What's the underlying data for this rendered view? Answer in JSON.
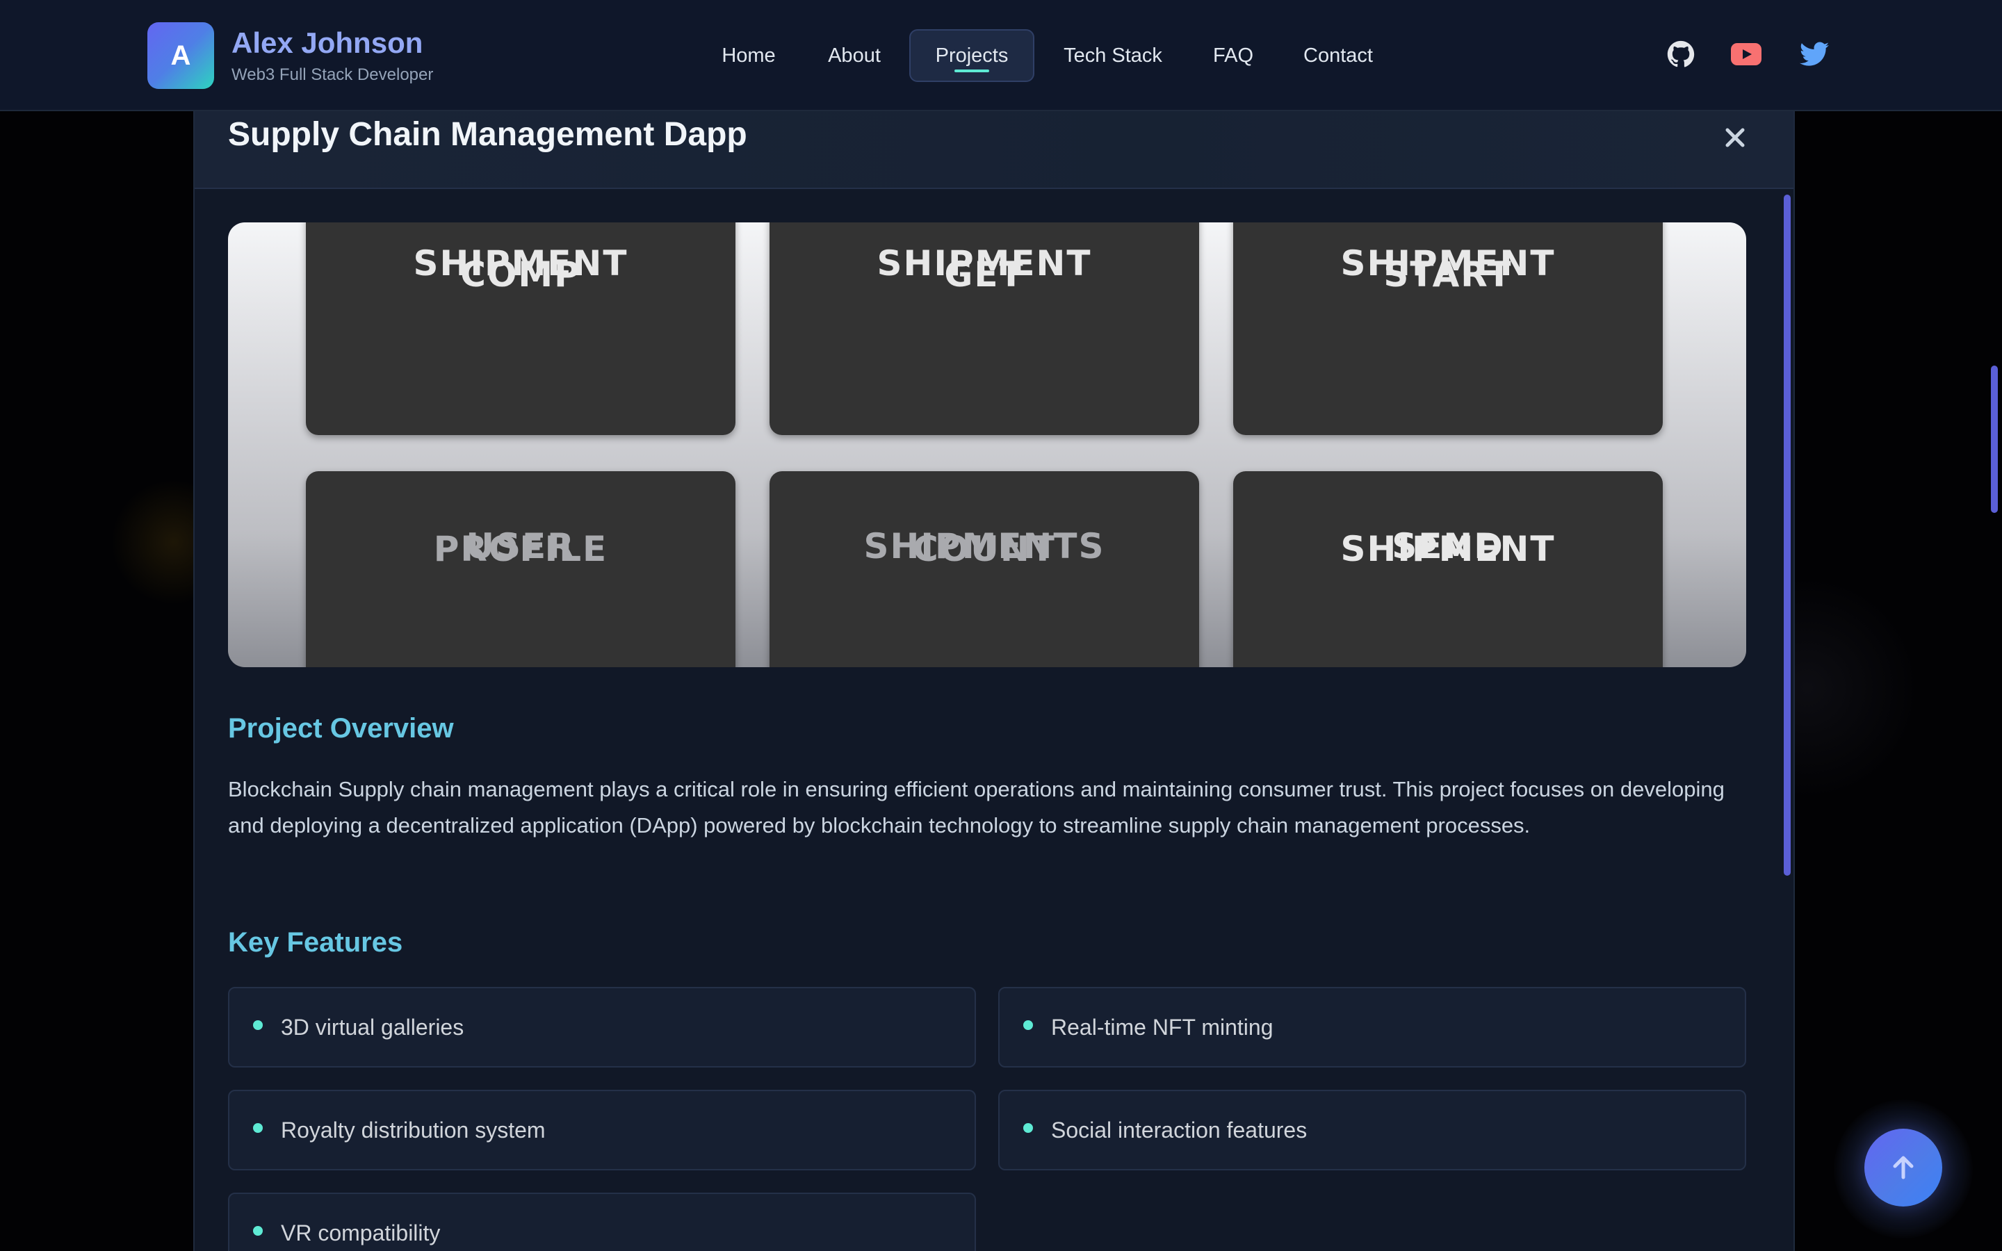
{
  "brand": {
    "initial": "A",
    "name": "Alex Johnson",
    "role": "Web3 Full Stack Developer"
  },
  "nav": {
    "items": [
      {
        "label": "Home",
        "active": false
      },
      {
        "label": "About",
        "active": false
      },
      {
        "label": "Projects",
        "active": true
      },
      {
        "label": "Tech Stack",
        "active": false
      },
      {
        "label": "FAQ",
        "active": false
      },
      {
        "label": "Contact",
        "active": false
      }
    ]
  },
  "social": [
    "github-icon",
    "youtube-icon",
    "twitter-icon"
  ],
  "modal": {
    "title": "Supply Chain Management Dapp",
    "close_icon": "close-icon",
    "hero_tiles": [
      {
        "line1": "COMP",
        "line2": "SHIPMENT"
      },
      {
        "line1": "GET",
        "line2": "SHIPMENT"
      },
      {
        "line1": "START",
        "line2": "SHIPMENT"
      },
      {
        "line1": "USER",
        "line2": "PROFILE"
      },
      {
        "line1": "SHIPMENTS",
        "line2": "COUNT"
      },
      {
        "line1": "SEND",
        "line2": "SHIPMENT"
      }
    ],
    "overview_heading": "Project Overview",
    "overview_text": "Blockchain Supply chain management plays a critical role in ensuring efficient operations and maintaining consumer trust. This project focuses on developing and deploying a decentralized application (DApp) powered by blockchain technology to streamline supply chain management processes.",
    "features_heading": "Key Features",
    "features": [
      "3D virtual galleries",
      "Real-time NFT minting",
      "Royalty distribution system",
      "Social interaction features",
      "VR compatibility"
    ]
  },
  "scroll_top_icon": "arrow-up-icon",
  "colors": {
    "accent_teal": "#5eead4",
    "heading_cyan": "#67c7e3",
    "brand_indigo": "#6366f1",
    "youtube_red": "#f87171",
    "twitter_blue": "#60a5fa"
  }
}
